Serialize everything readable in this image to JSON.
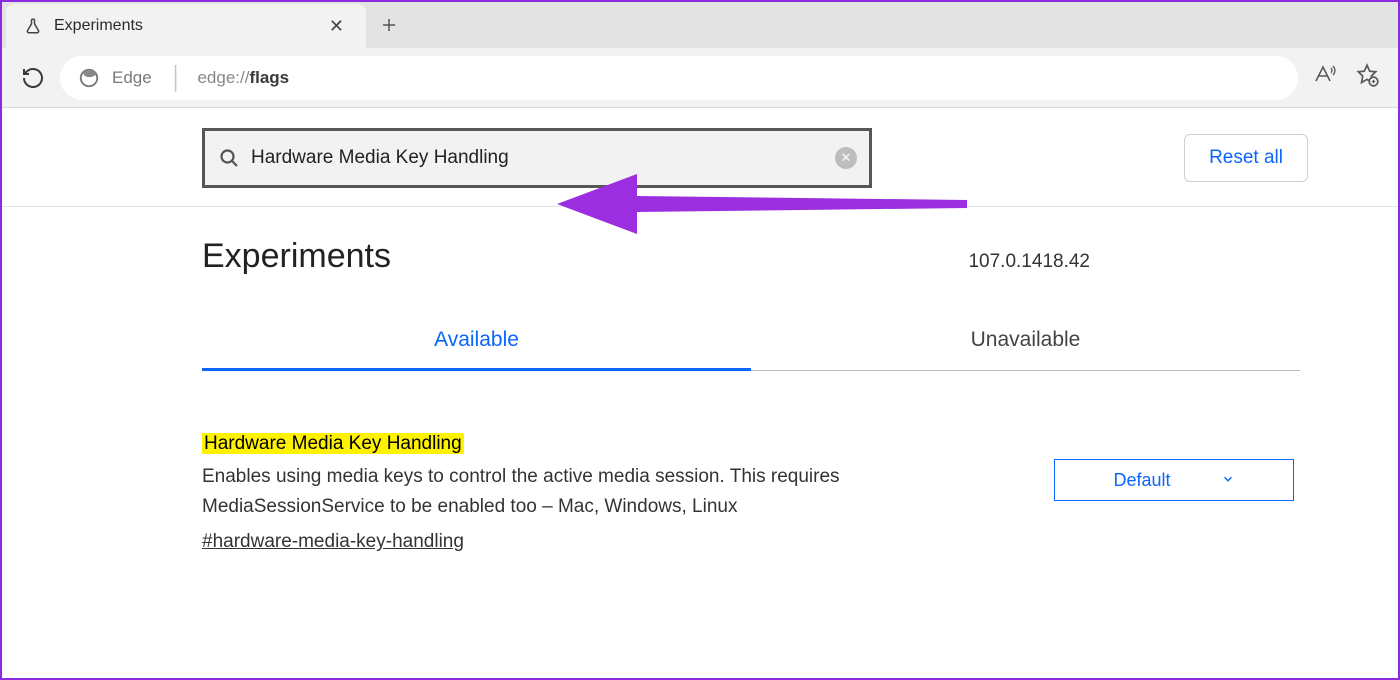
{
  "browser": {
    "tab_title": "Experiments",
    "omnibox_label": "Edge",
    "omnibox_url_prefix": "edge://",
    "omnibox_url_bold": "flags"
  },
  "topbar": {
    "search_value": "Hardware Media Key Handling",
    "reset_label": "Reset all"
  },
  "header": {
    "title": "Experiments",
    "version": "107.0.1418.42"
  },
  "tabs": {
    "available": "Available",
    "unavailable": "Unavailable"
  },
  "flag": {
    "title": "Hardware Media Key Handling",
    "description": "Enables using media keys to control the active media session. This requires MediaSessionService to be enabled too – Mac, Windows, Linux",
    "anchor": "#hardware-media-key-handling",
    "select_value": "Default"
  }
}
